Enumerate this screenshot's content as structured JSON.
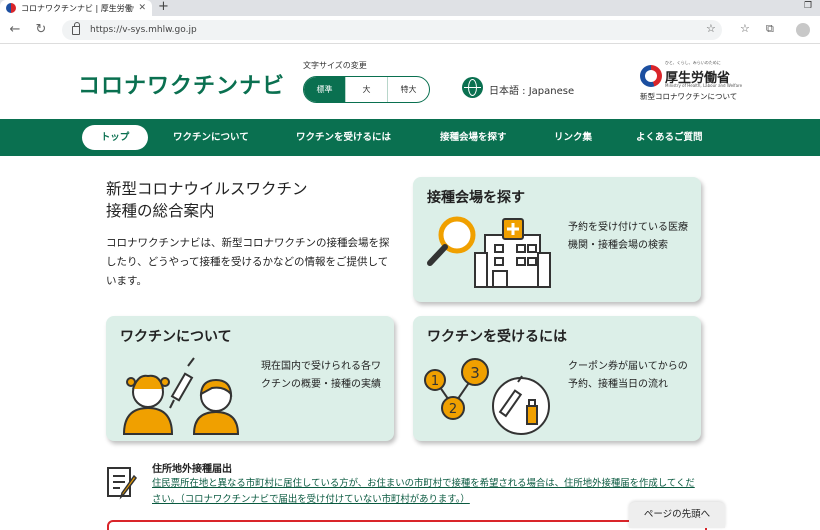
{
  "browser": {
    "tab_title": "コロナワクチンナビ | 厚生労働省",
    "tab_close": "✕",
    "new_tab": "+",
    "url": "https://v-sys.mhlw.go.jp",
    "back": "←",
    "reload": "↻"
  },
  "header": {
    "logo": "コロナワクチンナビ",
    "font_size_label": "文字サイズの変更",
    "font_sizes": [
      {
        "label": "標準",
        "active": true
      },
      {
        "label": "大",
        "active": false
      },
      {
        "label": "特大",
        "active": false
      }
    ],
    "language": "日本語 : Japanese",
    "ministry_small": "ひと、くらし、みらいのために",
    "ministry_name": "厚生労働省",
    "ministry_en": "Ministry of Health, Labour and Welfare",
    "ministry_sub": "新型コロナワクチンについて"
  },
  "nav": {
    "items": [
      "トップ",
      "ワクチンについて",
      "ワクチンを受けるには",
      "接種会場を探す",
      "リンク集",
      "よくあるご質問"
    ]
  },
  "hero": {
    "title_line1": "新型コロナウイルスワクチン",
    "title_line2": "接種の総合案内",
    "description": "コロナワクチンナビは、新型コロナワクチンの接種会場を探したり、どうやって接種を受けるかなどの情報をご提供しています。"
  },
  "cards": {
    "find": {
      "title": "接種会場を探す",
      "desc": "予約を受け付けている医療機関・接種会場の検索"
    },
    "about": {
      "title": "ワクチンについて",
      "desc": "現在国内で受けられる各ワクチンの概要・接種の実績"
    },
    "receive": {
      "title": "ワクチンを受けるには",
      "desc": "クーポン券が届いてからの予約、接種当日の流れ"
    }
  },
  "notice": {
    "title": "住所地外接種届出",
    "body": "住民票所在地と異なる市町村に居住している方が、お住まいの市町村で接種を希望される場合は、住所地外接種届を作成してください。（コロナワクチンナビで届出を受け付けていない市町村があります。）"
  },
  "page_top": "ページの先頭へ",
  "colors": {
    "brand_green": "#0a7050",
    "card_bg": "#dcefe8",
    "accent_orange": "#f0a000",
    "alert_red": "#d9252a"
  },
  "icons": [
    "magnifier-icon",
    "hospital-icon",
    "family-icon",
    "syringe-icon",
    "steps-icon",
    "vaccine-vial-icon",
    "document-pen-icon",
    "globe-icon"
  ]
}
